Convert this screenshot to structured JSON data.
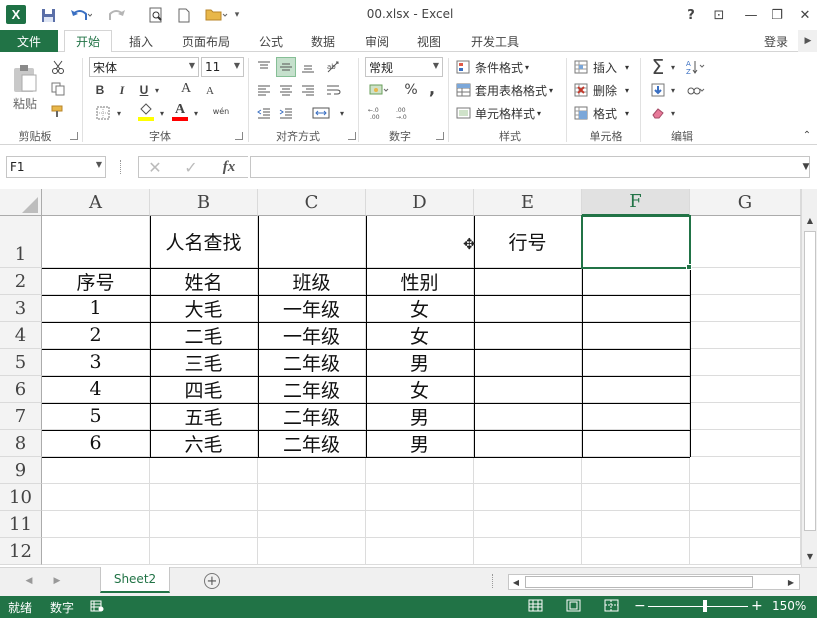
{
  "window": {
    "title": "00.xlsx - Excel",
    "logo": "X",
    "help": "?",
    "minimize": "—",
    "restore": "❐",
    "close": "✕",
    "ribbon_display": "⊡"
  },
  "qat": {
    "save_icon": "save-icon",
    "undo_icon": "undo-icon",
    "redo_icon": "redo-icon"
  },
  "tabs": {
    "file": "文件",
    "items": [
      "开始",
      "插入",
      "页面布局",
      "公式",
      "数据",
      "审阅",
      "视图",
      "开发工具"
    ],
    "active": "开始",
    "login": "登录"
  },
  "ribbon": {
    "clipboard": {
      "paste": "粘贴",
      "label": "剪贴板"
    },
    "font": {
      "name": "宋体",
      "size": "11",
      "bold": "B",
      "italic": "I",
      "underline": "U",
      "grow": "A",
      "shrink": "A",
      "wen": "wén",
      "label": "字体",
      "fill_color": "#ffff00",
      "font_color": "#ff0000"
    },
    "alignment": {
      "label": "对齐方式"
    },
    "number": {
      "format": "常规",
      "percent": "%",
      "comma": ",",
      "label": "数字"
    },
    "styles": {
      "conditional": "条件格式",
      "table": "套用表格格式",
      "cell": "单元格样式",
      "label": "样式"
    },
    "cells": {
      "insert": "插入",
      "delete": "删除",
      "format": "格式",
      "label": "单元格"
    },
    "editing": {
      "sum": "Σ",
      "sort": "A Z",
      "label": "编辑"
    }
  },
  "formula_bar": {
    "name_box": "F1",
    "cancel": "✕",
    "enter": "✓",
    "fx": "fx",
    "value": ""
  },
  "sheet": {
    "columns": [
      "A",
      "B",
      "C",
      "D",
      "E",
      "F",
      "G"
    ],
    "selected_column": "F",
    "rows": [
      "1",
      "2",
      "3",
      "4",
      "5",
      "6",
      "7",
      "8",
      "9",
      "10",
      "11",
      "12"
    ],
    "row1": {
      "B": "人名查找",
      "E": "行号"
    },
    "header": [
      "序号",
      "姓名",
      "班级",
      "性别"
    ],
    "data": [
      [
        "1",
        "大毛",
        "一年级",
        "女"
      ],
      [
        "2",
        "二毛",
        "一年级",
        "女"
      ],
      [
        "3",
        "三毛",
        "二年级",
        "男"
      ],
      [
        "4",
        "四毛",
        "二年级",
        "女"
      ],
      [
        "5",
        "五毛",
        "二年级",
        "男"
      ],
      [
        "6",
        "六毛",
        "二年级",
        "男"
      ]
    ],
    "active_cell": "F1"
  },
  "sheet_tabs": {
    "name": "Sheet2",
    "add": "+"
  },
  "status": {
    "ready": "就绪",
    "numlock": "数字",
    "zoom": "150%",
    "zoom_minus": "−",
    "zoom_plus": "+"
  },
  "colors": {
    "accent": "#217346",
    "selection": "#217346",
    "grid_line": "#dcdcdc",
    "table_border": "#000000"
  }
}
